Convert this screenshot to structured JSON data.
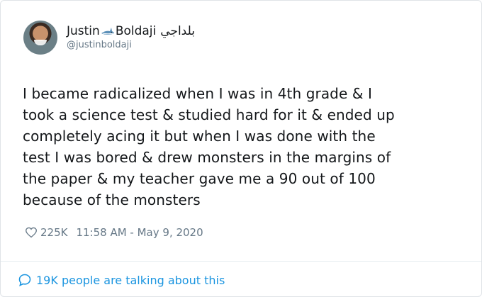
{
  "tweet": {
    "author": {
      "first_name": "Justin",
      "emoji_icon": "shark-icon",
      "last_name": "Boldaji",
      "arabic_name": "بلداجي",
      "handle": "@justinboldaji"
    },
    "text": "I became radicalized when I was in 4th grade & I\ntook a science test & studied hard for it & ended up\ncompletely acing it but when I was done with the\ntest I was bored & drew monsters in the margins of\nthe paper & my teacher gave me a 90 out of 100\nbecause of the monsters",
    "likes": "225K",
    "timestamp": "11:58 AM - May 9, 2020",
    "conversation": "19K people are talking about this"
  },
  "colors": {
    "link": "#1b95e0",
    "secondary_text": "#657786",
    "text": "#14171a"
  }
}
